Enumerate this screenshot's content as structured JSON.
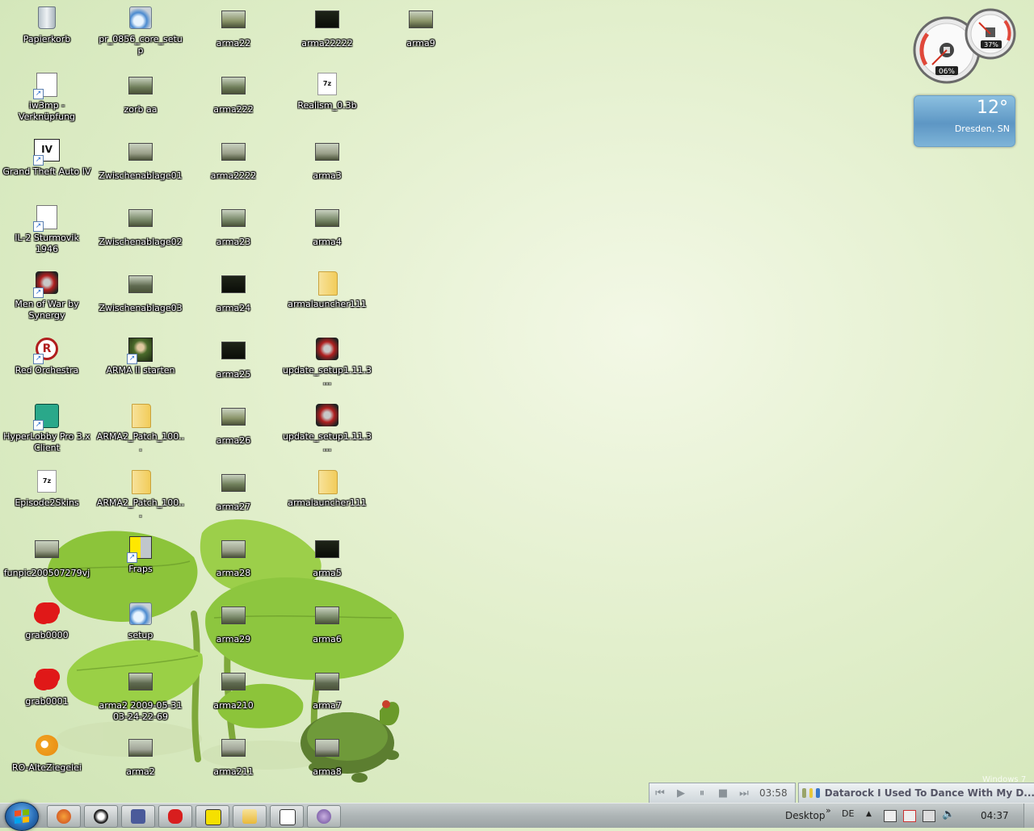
{
  "desktop": {
    "icons": [
      {
        "label": "Papierkorb",
        "type": "bin"
      },
      {
        "label": "iw3mp - Verknüpfung",
        "type": "app"
      },
      {
        "label": "Grand Theft Auto IV",
        "type": "gta"
      },
      {
        "label": "IL-2 Sturmovik 1946",
        "type": "app"
      },
      {
        "label": "Men of War by Synergy",
        "type": "mow"
      },
      {
        "label": "Red Orchestra",
        "type": "ro"
      },
      {
        "label": "HyperLobby Pro 3.x Client",
        "type": "hl"
      },
      {
        "label": "Episode2Skins",
        "type": "7z"
      },
      {
        "label": "funpic200507279vj",
        "type": "thumb"
      },
      {
        "label": "grab0000",
        "type": "splat"
      },
      {
        "label": "grab0001",
        "type": "splat"
      },
      {
        "label": "RO-AlteZiegelei",
        "type": "bird"
      },
      {
        "label": "pr_0856_core_setup",
        "type": "setup"
      },
      {
        "label": "zorb aa",
        "type": "thumb"
      },
      {
        "label": "Zwischenablage01",
        "type": "thumb"
      },
      {
        "label": "Zwischenablage02",
        "type": "thumb"
      },
      {
        "label": "Zwischenablage03",
        "type": "thumb"
      },
      {
        "label": "ARMA II starten",
        "type": "arma"
      },
      {
        "label": "ARMA2_Patch_100...",
        "type": "folder"
      },
      {
        "label": "ARMA2_Patch_100...",
        "type": "folder"
      },
      {
        "label": "Fraps",
        "type": "fraps"
      },
      {
        "label": "setup",
        "type": "setup"
      },
      {
        "label": "arma2 2009-05-31 03-24-22-69",
        "type": "thumb"
      },
      {
        "label": "arma2",
        "type": "thumb"
      },
      {
        "label": "arma22",
        "type": "thumb"
      },
      {
        "label": "arma222",
        "type": "thumb"
      },
      {
        "label": "arma2222",
        "type": "thumb"
      },
      {
        "label": "arma23",
        "type": "thumb"
      },
      {
        "label": "arma24",
        "type": "thumbdark"
      },
      {
        "label": "arma25",
        "type": "thumbdark"
      },
      {
        "label": "arma26",
        "type": "thumb"
      },
      {
        "label": "arma27",
        "type": "thumb"
      },
      {
        "label": "arma28",
        "type": "thumb"
      },
      {
        "label": "arma29",
        "type": "thumb"
      },
      {
        "label": "arma210",
        "type": "thumb"
      },
      {
        "label": "arma211",
        "type": "thumb"
      },
      {
        "label": "arma22222",
        "type": "thumbdark"
      },
      {
        "label": "Realism_0.3b",
        "type": "7z"
      },
      {
        "label": "arma3",
        "type": "thumb"
      },
      {
        "label": "arma4",
        "type": "thumb"
      },
      {
        "label": "armalauncher111",
        "type": "folder"
      },
      {
        "label": "update_setup1.11.3...",
        "type": "mow"
      },
      {
        "label": "update_setup1.11.3...",
        "type": "mow"
      },
      {
        "label": "armalauncher111",
        "type": "folder"
      },
      {
        "label": "arma5",
        "type": "thumbdark"
      },
      {
        "label": "arma6",
        "type": "thumb"
      },
      {
        "label": "arma7",
        "type": "thumb"
      },
      {
        "label": "arma8",
        "type": "thumb"
      },
      {
        "label": "arma9",
        "type": "thumb"
      }
    ]
  },
  "gadgets": {
    "cpu_percent": "06%",
    "memory_percent": "37%",
    "weather_temp": "12°",
    "weather_city": "Dresden, SN"
  },
  "media": {
    "time": "03:58",
    "now_playing": "Datarock  I Used To Dance With My D..."
  },
  "watermark": "Windows 7",
  "taskbar": {
    "toolbar_label": "Desktop",
    "language": "DE",
    "clock": "04:37",
    "buttons": [
      "firefox",
      "penguin",
      "teamspeak",
      "splat",
      "fraps",
      "explorer",
      "console",
      "ventrilo"
    ]
  },
  "colors": {
    "label_text": "#ffffff",
    "taskbar": "#aeb5b6",
    "weather_bg": "#5d96c4"
  }
}
